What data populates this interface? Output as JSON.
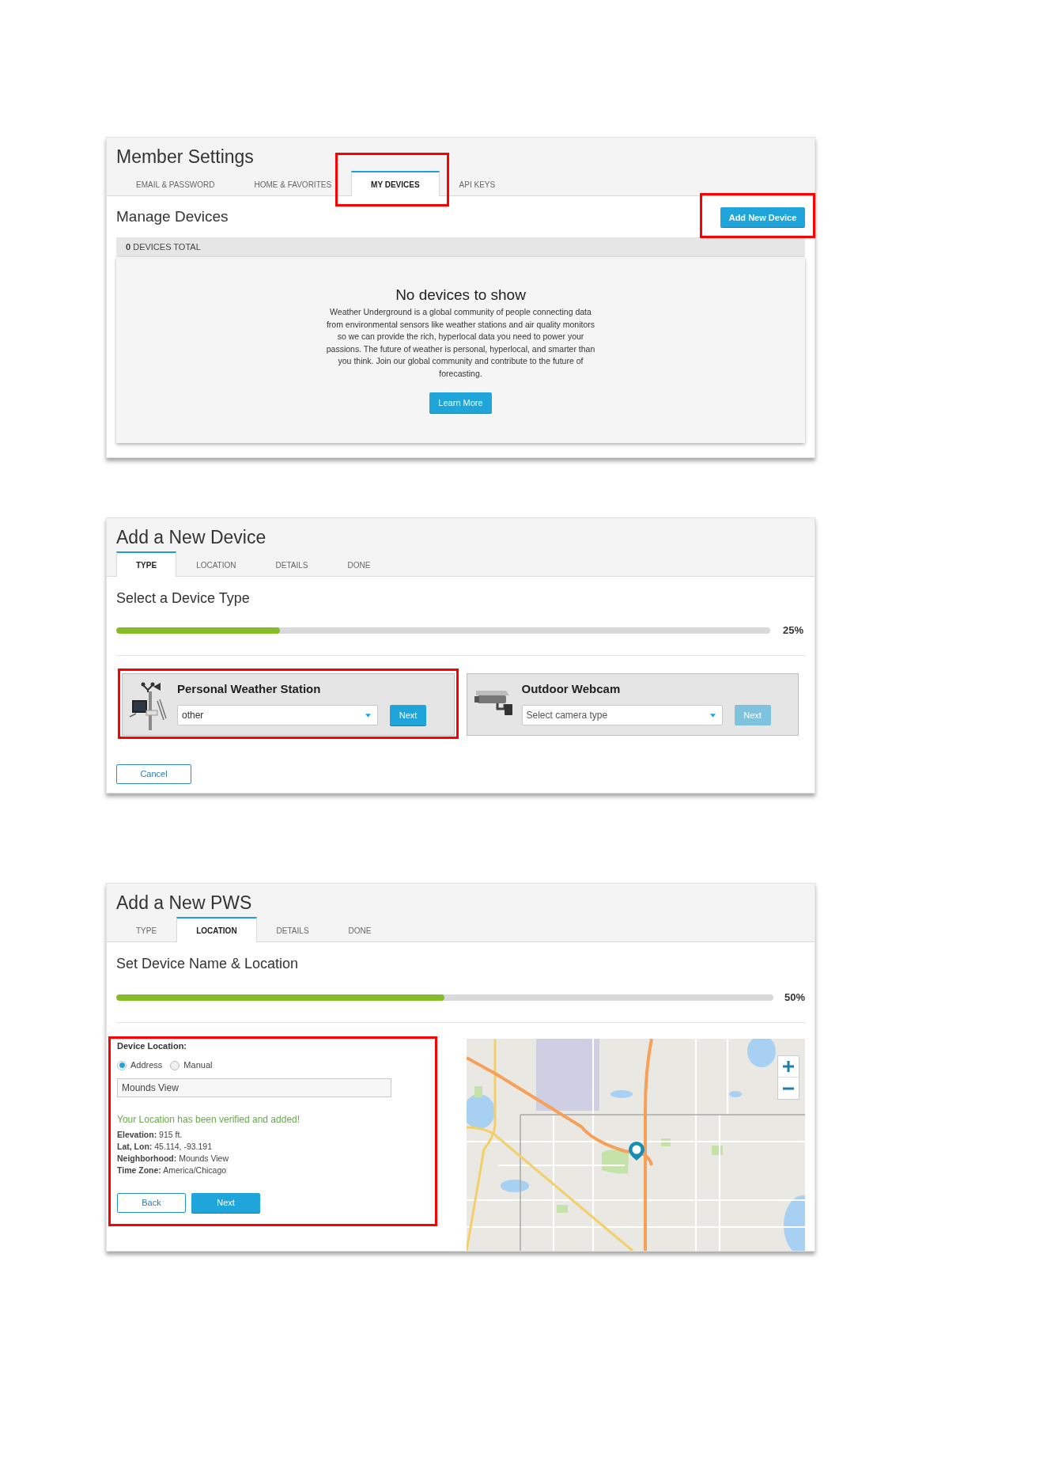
{
  "panels": [
    {
      "kind": "member_settings",
      "title": "Member Settings",
      "tabs": [
        {
          "label": "EMAIL & PASSWORD",
          "selected": false,
          "highlighted": false
        },
        {
          "label": "HOME & FAVORITES",
          "selected": false,
          "highlighted": false
        },
        {
          "label": "MY DEVICES",
          "selected": true,
          "highlighted": true
        },
        {
          "label": "API KEYS",
          "selected": false,
          "highlighted": false
        }
      ],
      "heading": "Manage Devices",
      "add_button": {
        "label": "Add New Device",
        "highlighted": true
      },
      "count_bar": "**0** DEVICES TOTAL",
      "empty_state": {
        "title": "No devices to show",
        "text": "Weather Underground is a global community of people connecting data from environmental sensors like weather stations and air quality monitors so we can provide the rich, hyperlocal data you need to power your passions. The future of weather is personal, hyperlocal, and smarter than you think. Join our global community and contribute to the future of forecasting.",
        "button": "Learn More"
      }
    },
    {
      "kind": "device_type",
      "title": "Add a New Device",
      "tabs": [
        {
          "label": "TYPE",
          "selected": true
        },
        {
          "label": "LOCATION",
          "selected": false
        },
        {
          "label": "DETAILS",
          "selected": false
        },
        {
          "label": "DONE",
          "selected": false
        }
      ],
      "heading": "Select a Device Type",
      "progress": {
        "level": 0.25,
        "reading": "25%"
      },
      "device_types": [
        {
          "kind": "station",
          "name": "Personal Weather Station",
          "dropdown": {
            "value": "other"
          },
          "next": {
            "label": "Next",
            "disabled": false
          },
          "highlighted": true
        },
        {
          "kind": "webcam",
          "name": "Outdoor Webcam",
          "dropdown": {
            "placeholder": "Select camera type"
          },
          "next": {
            "label": "Next",
            "disabled": true
          },
          "highlighted": false
        }
      ],
      "cancel": "Cancel"
    },
    {
      "kind": "location",
      "title": "Add a New PWS",
      "tabs": [
        {
          "label": "TYPE",
          "selected": false
        },
        {
          "label": "LOCATION",
          "selected": true
        },
        {
          "label": "DETAILS",
          "selected": false
        },
        {
          "label": "DONE",
          "selected": false
        }
      ],
      "heading": "Set Device Name & Location",
      "progress": {
        "level": 0.5,
        "reading": "50%"
      },
      "location_form": {
        "highlighted": true,
        "label": "Device Location:",
        "radios": [
          {
            "label": "Address",
            "selected": true
          },
          {
            "label": "Manual",
            "selected": false
          }
        ],
        "address": {
          "value": "Mounds View"
        },
        "message": "Your Location has been verified and added!",
        "details": [
          "**Elevation:** 915 ft.",
          "**Lat, Lon:** 45.114, -93.191",
          "**Neighborhood:** Mounds View",
          "**Time Zone:** America/Chicago"
        ],
        "buttons": [
          {
            "label": "Back",
            "kind": "secondary"
          },
          {
            "label": "Next",
            "kind": "primary"
          }
        ]
      }
    }
  ]
}
